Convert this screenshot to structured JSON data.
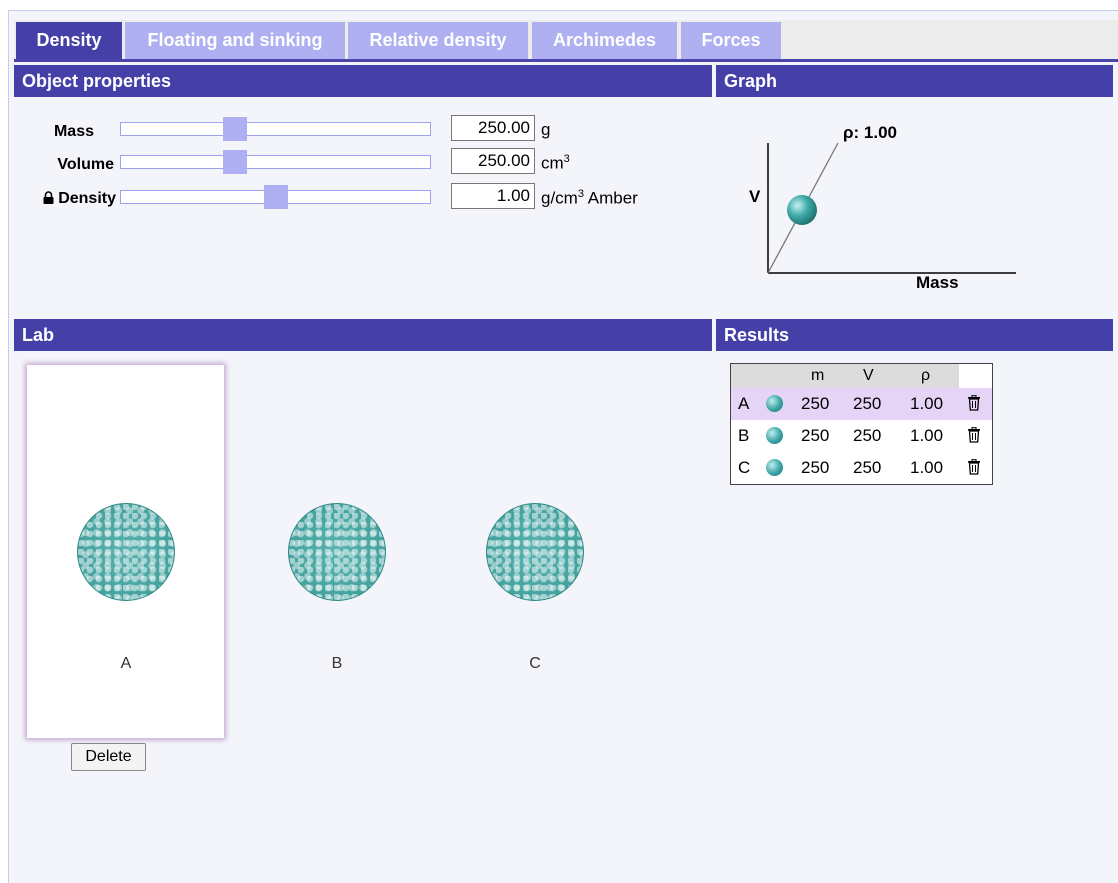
{
  "tabs": [
    {
      "label": "Density",
      "active": true
    },
    {
      "label": "Floating and sinking",
      "active": false
    },
    {
      "label": "Relative density",
      "active": false
    },
    {
      "label": "Archimedes",
      "active": false
    },
    {
      "label": "Forces",
      "active": false
    }
  ],
  "object_properties": {
    "title": "Object properties",
    "mass": {
      "label": "Mass",
      "value": "250.00",
      "unit": "g",
      "slider_fraction": 0.37
    },
    "volume": {
      "label": "Volume",
      "value": "250.00",
      "unit": "cm",
      "unit_sup": "3",
      "slider_fraction": 0.37
    },
    "density": {
      "label": "Density",
      "value": "1.00",
      "unit": "g/cm",
      "unit_sup": "3",
      "material": "Amber",
      "locked": true,
      "slider_fraction": 0.5
    },
    "lock_icon": "lock-icon"
  },
  "graph": {
    "title": "Graph",
    "rho_label": "ρ: 1.00",
    "y_label": "V",
    "x_label": "Mass"
  },
  "lab": {
    "title": "Lab",
    "objects": [
      {
        "label": "A",
        "selected": true
      },
      {
        "label": "B",
        "selected": false
      },
      {
        "label": "C",
        "selected": false
      }
    ],
    "delete_label": "Delete"
  },
  "results": {
    "title": "Results",
    "headers": {
      "m": "m",
      "v": "V",
      "rho": "ρ"
    },
    "rows": [
      {
        "id": "A",
        "m": "250",
        "v": "250",
        "rho": "1.00",
        "selected": true
      },
      {
        "id": "B",
        "m": "250",
        "v": "250",
        "rho": "1.00",
        "selected": false
      },
      {
        "id": "C",
        "m": "250",
        "v": "250",
        "rho": "1.00",
        "selected": false
      }
    ]
  },
  "colors": {
    "accent": "#4440a8",
    "tab_inactive": "#aeb0f2",
    "object": "#3a9a97",
    "selected_row": "#e6d4f7"
  }
}
